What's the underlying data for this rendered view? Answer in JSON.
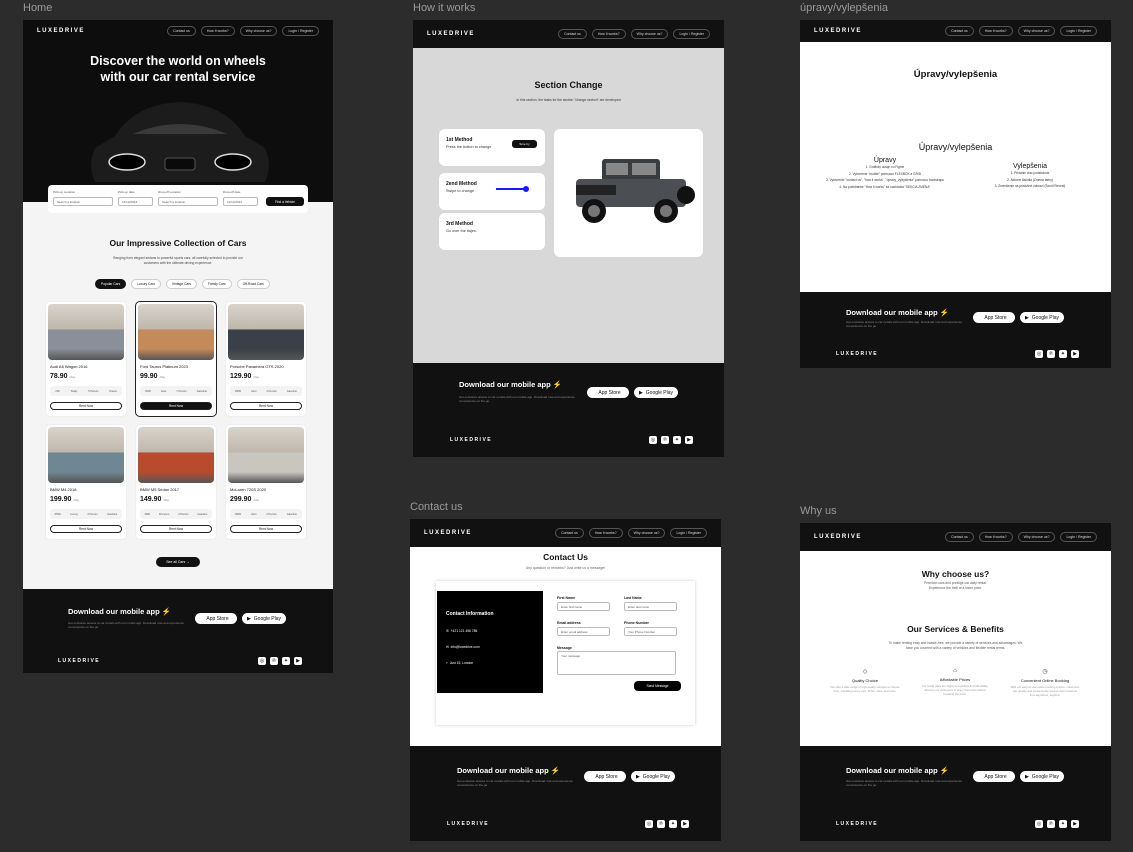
{
  "frames": {
    "home": "Home",
    "how": "How it works",
    "upravy": "úpravy/vylepšenia",
    "contact": "Contact us",
    "why": "Why us"
  },
  "nav": {
    "logo": "LUXEDRIVE",
    "items": [
      "Contact us",
      "How it works?",
      "Why choose us?",
      "Login / Register"
    ]
  },
  "home": {
    "hero_title_1": "Discover the world on wheels",
    "hero_title_2": "with our car rental service",
    "search": {
      "pickup_label": "Pick-up Location",
      "pickup_placeholder": "Search a location",
      "pickup_date_label": "Pick-up date",
      "pickup_date": "12/12/2024",
      "dropoff_label": "Drop-off Location",
      "dropoff_placeholder": "Search a location",
      "dropoff_date_label": "Drop-off date",
      "dropoff_date": "12/12/2024",
      "button": "Find a Vehicle"
    },
    "collection_title": "Our Impressive Collection of Cars",
    "collection_sub_1": "Ranging from elegant sedans to powerful sports cars, all carefully selected to provide our",
    "collection_sub_2": "customers with the ultimate driving experience.",
    "tabs": [
      "Popular Cars",
      "Luxury Cars",
      "Vintage Cars",
      "Family Cars",
      "Off-Road Cars"
    ],
    "cars": [
      {
        "name": "Audi A6 Wagon 2016",
        "price": "78.90",
        "unit": "/day",
        "specs": [
          "200",
          "Today",
          "5 Person",
          "Diesel"
        ],
        "btn": "Rent Now",
        "color": "#8a8f99"
      },
      {
        "name": "Ford Taurus Platinum 2023",
        "price": "99.90",
        "unit": "/day",
        "specs": [
          "4WD",
          "Auto",
          "7 Person",
          "Gasoline"
        ],
        "btn": "Rent Now",
        "color": "#c58a5a"
      },
      {
        "name": "Porsche Panamera GTS 2020",
        "price": "129.90",
        "unit": "/day",
        "specs": [
          "RWD",
          "Auto",
          "4 Person",
          "Gasoline"
        ],
        "btn": "Rent Now",
        "color": "#3a4049"
      },
      {
        "name": "BMW M4 2018",
        "price": "199.90",
        "unit": "/day",
        "specs": [
          "RWD",
          "Luxury",
          "4 Person",
          "Gasoline"
        ],
        "btn": "Rent Now",
        "color": "#6f8792"
      },
      {
        "name": "BMW M5 Sedan 2017",
        "price": "149.90",
        "unit": "/day",
        "specs": [
          "4WD",
          "Premium",
          "4 Person",
          "Gasoline"
        ],
        "btn": "Rent Now",
        "color": "#b84a2e"
      },
      {
        "name": "McLaren 720S 2020",
        "price": "299.90",
        "unit": "/day",
        "specs": [
          "RWD",
          "Auto",
          "2 Person",
          "Gasoline"
        ],
        "btn": "Rent Now",
        "color": "#c9c6bf"
      }
    ],
    "see_all": "See all Cars"
  },
  "how": {
    "title": "Section Change",
    "sub": "In this section, the tasks for the section \"change section\" are developed",
    "methods": [
      {
        "title": "1st Method",
        "desc": "Press the button to change",
        "btn": "Sme by"
      },
      {
        "title": "2end Method",
        "desc": "Swipe to change"
      },
      {
        "title": "3rd Method",
        "desc": "Go over the tiajes."
      }
    ]
  },
  "upravy": {
    "title": "Úpravy/vylepšenia",
    "title2": "Úpravy/vylepšenia",
    "left_title": "Úpravy",
    "left_items": [
      "1. Grafický dizajn vo Figme",
      "2. Vytvorenie \"mobile\" pomocou FLEXBOX a GRID",
      "3. Vytvorenie \"contact us\", \"how it works\", \"úpravy_vylepšenia\" pomocou bootstrapu",
      "4. Na podstránke \"How it works\" sa nachádza \"SEKCIA ZMENA\""
    ],
    "right_title": "Vylepšenia",
    "right_items": [
      "1. Pridanie viac podstránok",
      "2. Aktívne tlačidlá (Zmena farby)",
      "3. Zmenšenie na príslušné zobrazí (Scroll Reveal)"
    ]
  },
  "contact": {
    "title": "Contact Us",
    "sub": "Any question or remarks? Just write us a message!",
    "info_title": "Contact Information",
    "phone": "+421 121 456 786",
    "email": "info@luxedrive.com",
    "address": "Just 15, London",
    "first_name": "First Name",
    "first_ph": "Enter first name",
    "last_name": "Last Name",
    "last_ph": "Enter last name",
    "email_label": "Email address",
    "email_ph": "Enter email address",
    "phone_label": "Phone Number",
    "phone_ph": "Your Phone Number",
    "message_label": "Message",
    "message_ph": "Your message",
    "send": "Send Message"
  },
  "why": {
    "title": "Why choose us?",
    "sub1": "Premium cars and prestige car daily rental.",
    "sub2": "Experience the thrill at a lower price.",
    "services_title": "Our Services & Benefits",
    "services_sub1": "To make renting easy and hassle-free, we provide a variety of services and advantages. We",
    "services_sub2": "have you covered with a variety of vehicles and flexible rental terms.",
    "services": [
      {
        "title": "Quality Choice",
        "desc": "We offer a wide range of high-quality vehicles to choose from, including luxury cars, SUVs, vans, and more."
      },
      {
        "title": "Affordable Prices",
        "desc": "Our rental rates are highly competitive and affordable, allowing our customers to enjoy their trips without breaking the bank."
      },
      {
        "title": "Convenient Online Booking",
        "desc": "With our easy-to-use online booking system, customers can quickly and conveniently reserve their rental car from anywhere, anytime."
      }
    ]
  },
  "footer": {
    "download": "Download our mobile app",
    "bolt": "⚡",
    "sub": "Get exclusive access to car rentals with our mobile app. Download now and experience convenience on the go.",
    "app_store": "App Store",
    "google_play": "Google Play",
    "logo": "LUXEDRIVE"
  }
}
